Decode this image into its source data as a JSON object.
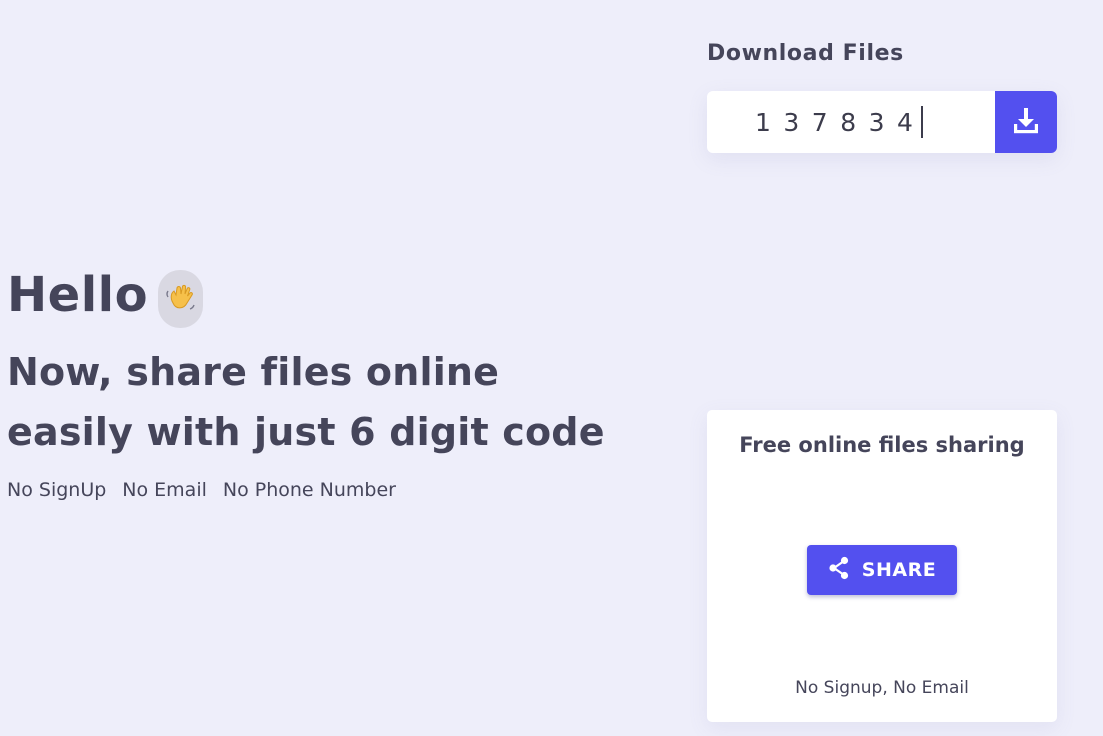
{
  "download": {
    "title": "Download Files",
    "code_value": "137834",
    "button_icon": "download-icon"
  },
  "hero": {
    "greeting": "Hello",
    "greeting_icon": "waving-hand-icon",
    "headline": "Now, share files online easily with just 6 digit code",
    "features": [
      "No SignUp",
      "No Email",
      "No Phone Number"
    ]
  },
  "share_card": {
    "title": "Free online files sharing",
    "button_label": "SHARE",
    "button_icon": "share-icon",
    "note": "No Signup, No Email"
  },
  "colors": {
    "background": "#eeeefa",
    "accent": "#5350ef",
    "text": "#45455a",
    "card": "#ffffff"
  }
}
